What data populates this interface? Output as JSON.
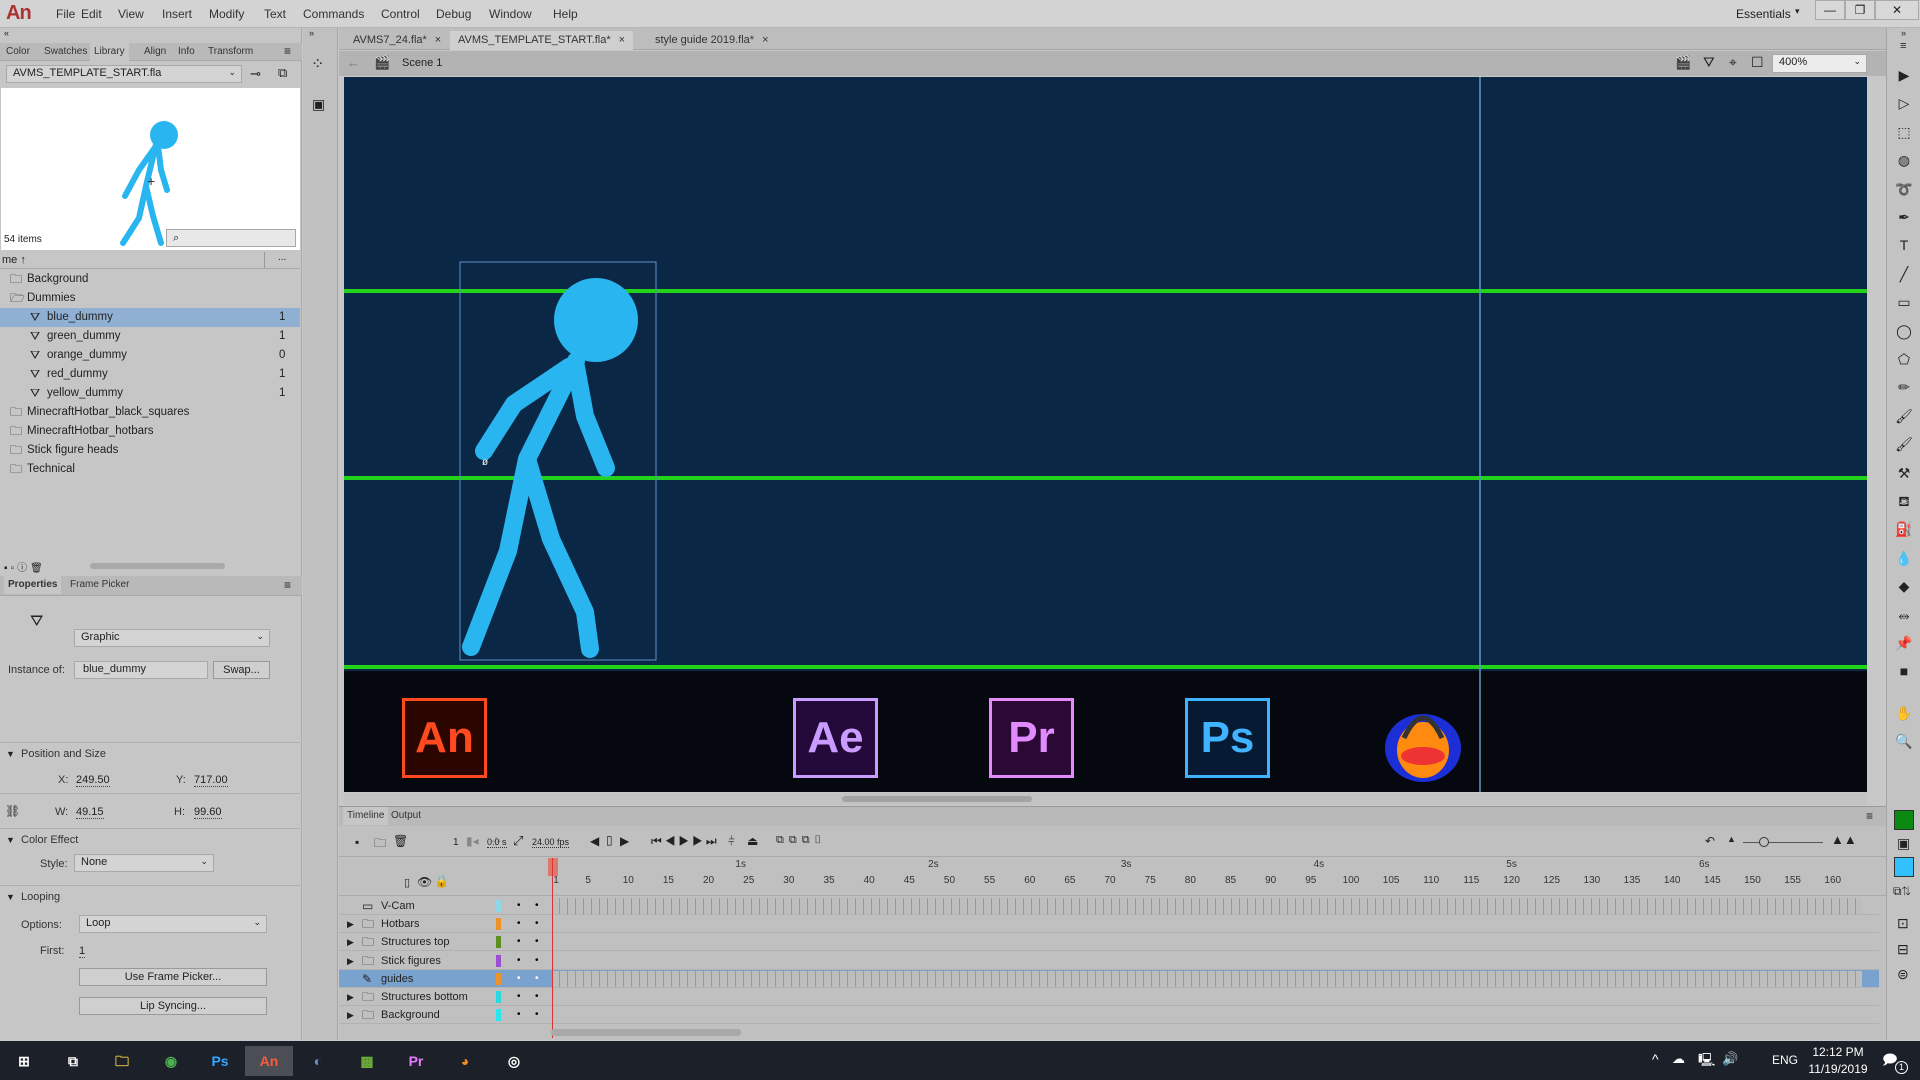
{
  "app": {
    "logo": "An",
    "menu": [
      "File",
      "Edit",
      "View",
      "Insert",
      "Modify",
      "Text",
      "Commands",
      "Control",
      "Debug",
      "Window",
      "Help"
    ],
    "workspace": "Essentials"
  },
  "left_panel": {
    "tabs": [
      "Color",
      "Swatches",
      "Library",
      "Align",
      "Info",
      "Transform"
    ],
    "active_tab": "Library",
    "library_file": "AVMS_TEMPLATE_START.fla",
    "item_count": "54 items",
    "name_header": "me ↑",
    "more": "...",
    "items": [
      {
        "label": "Background",
        "type": "folder",
        "indent": 0,
        "count": ""
      },
      {
        "label": "Dummies",
        "type": "folder-open",
        "indent": 0,
        "count": ""
      },
      {
        "label": "blue_dummy",
        "type": "graphic",
        "indent": 1,
        "count": "1",
        "selected": true
      },
      {
        "label": "green_dummy",
        "type": "graphic",
        "indent": 1,
        "count": "1"
      },
      {
        "label": "orange_dummy",
        "type": "graphic",
        "indent": 1,
        "count": "0"
      },
      {
        "label": "red_dummy",
        "type": "graphic",
        "indent": 1,
        "count": "1"
      },
      {
        "label": "yellow_dummy",
        "type": "graphic",
        "indent": 1,
        "count": "1"
      },
      {
        "label": "MinecraftHotbar_black_squares",
        "type": "folder",
        "indent": 0,
        "count": ""
      },
      {
        "label": "MinecraftHotbar_hotbars",
        "type": "folder",
        "indent": 0,
        "count": ""
      },
      {
        "label": "Stick figure heads",
        "type": "folder",
        "indent": 0,
        "count": ""
      },
      {
        "label": "Technical",
        "type": "folder",
        "indent": 0,
        "count": ""
      }
    ]
  },
  "properties": {
    "tabs": [
      "Properties",
      "Frame Picker"
    ],
    "symbol_type": "Graphic",
    "instance_label": "Instance of:",
    "instance_value": "blue_dummy",
    "swap": "Swap...",
    "position_title": "Position and Size",
    "x_label": "X:",
    "x": "249.50",
    "y_label": "Y:",
    "y": "717.00",
    "w_label": "W:",
    "w": "49.15",
    "h_label": "H:",
    "h": "99.60",
    "color_effect_title": "Color Effect",
    "style_label": "Style:",
    "style": "None",
    "looping_title": "Looping",
    "options_label": "Options:",
    "options": "Loop",
    "first_label": "First:",
    "first": "1",
    "frame_picker_btn": "Use Frame Picker...",
    "lip_sync_btn": "Lip Syncing..."
  },
  "documents": {
    "tabs": [
      {
        "label": "AVMS7_24.fla*"
      },
      {
        "label": "AVMS_TEMPLATE_START.fla*",
        "active": true
      },
      {
        "label": "style guide 2019.fla*"
      }
    ],
    "scene": "Scene 1",
    "zoom": "400%"
  },
  "stage": {
    "background": "#0b2746",
    "guide_color": "#22d31a",
    "figure_color": "#29b6f0",
    "app_icons": [
      {
        "label": "An",
        "color": "#ff4a1f",
        "bg": "#2b0600"
      },
      {
        "label": "Ae",
        "color": "#c99cff",
        "bg": "#230a3a"
      },
      {
        "label": "Pr",
        "color": "#e48aff",
        "bg": "#2a0a35"
      },
      {
        "label": "Ps",
        "color": "#3fb3ff",
        "bg": "#061a33"
      }
    ]
  },
  "timeline": {
    "tabs": [
      "Timeline",
      "Output"
    ],
    "current_frame": "1",
    "time": "0.0 s",
    "fps": "24.00 fps",
    "seconds": [
      "1s",
      "2s",
      "3s",
      "4s",
      "5s",
      "6s"
    ],
    "frame_labels": [
      "1",
      "5",
      "10",
      "15",
      "20",
      "25",
      "30",
      "35",
      "40",
      "45",
      "50",
      "55",
      "60",
      "65",
      "70",
      "75",
      "80",
      "85",
      "90",
      "95",
      "100",
      "105",
      "110",
      "115",
      "120",
      "125",
      "130",
      "135",
      "140",
      "145",
      "150",
      "155",
      "160"
    ],
    "layers": [
      {
        "name": "V-Cam",
        "color": "#8fd6e8",
        "icon": "camera",
        "expand": false,
        "frames": true
      },
      {
        "name": "Hotbars",
        "color": "#f0922a",
        "icon": "folder",
        "expand": true
      },
      {
        "name": "Structures top",
        "color": "#5e8f1e",
        "icon": "folder",
        "expand": true
      },
      {
        "name": "Stick figures",
        "color": "#9c4fd0",
        "icon": "folder",
        "expand": true
      },
      {
        "name": "guides",
        "color": "#f0922a",
        "icon": "guide",
        "expand": false,
        "selected": true,
        "frames": true
      },
      {
        "name": "Structures bottom",
        "color": "#2ad8e0",
        "icon": "folder",
        "expand": true
      },
      {
        "name": "Background",
        "color": "#2ae6f0",
        "icon": "folder",
        "expand": true
      }
    ]
  },
  "tools": [
    "selection",
    "subselection",
    "free-transform",
    "3d-rotation",
    "lasso",
    "pen",
    "text",
    "line",
    "rectangle",
    "oval",
    "polystar",
    "pencil",
    "brush",
    "paint-brush",
    "bone",
    "paint-bucket",
    "ink-bottle",
    "eyedropper",
    "eraser",
    "width",
    "pin",
    "camera",
    "hand",
    "zoom"
  ],
  "swatches": {
    "stroke": "#0b8a12",
    "fill": "#33c0ff"
  },
  "taskbar": {
    "apps": [
      "start",
      "task-view",
      "file-explorer",
      "chrome",
      "photoshop",
      "animate",
      "discord",
      "minecraft",
      "premiere",
      "audacity",
      "obs"
    ],
    "language": "ENG",
    "time": "12:12 PM",
    "date": "11/19/2019",
    "notifications": "1"
  }
}
